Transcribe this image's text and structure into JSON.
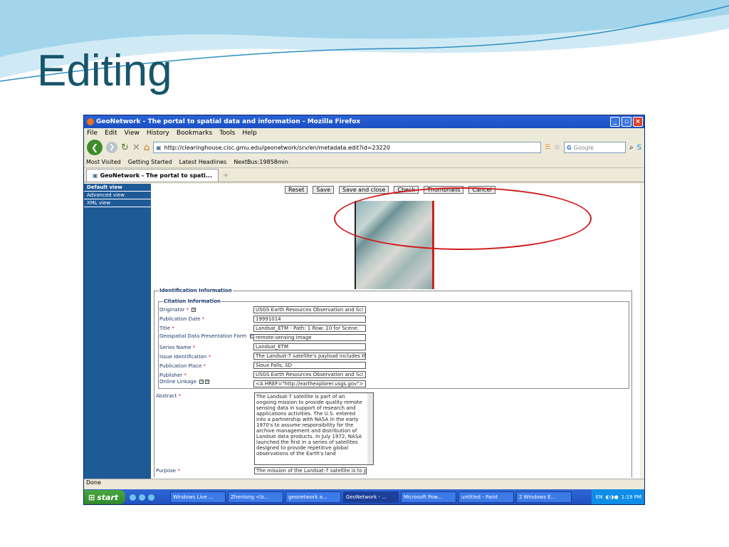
{
  "slide": {
    "title": "Editing"
  },
  "window": {
    "title": "GeoNetwork - The portal to spatial data and information - Mozilla Firefox"
  },
  "menu": [
    "File",
    "Edit",
    "View",
    "History",
    "Bookmarks",
    "Tools",
    "Help"
  ],
  "url": "http://clearinghouse.cisc.gmu.edu/geonetwork/srv/en/metadata.edit?id=23220",
  "search_placeholder": "Google",
  "bookmarks": [
    "Most Visited",
    "Getting Started",
    "Latest Headlines",
    "NextBus:19858min"
  ],
  "tab": {
    "label": "GeoNetwork - The portal to spati...",
    "new": "+"
  },
  "sidebar": [
    "Default view",
    "Advanced view",
    "XML view"
  ],
  "actions": [
    "Reset",
    "Save",
    "Save and close",
    "Check",
    "Thumbnails",
    "Cancel"
  ],
  "identification": {
    "title": "Identification Information",
    "citation_title": "Citation Information"
  },
  "fields": [
    {
      "label": "Originator",
      "value": "USGS Earth Resources Observation and Sci"
    },
    {
      "label": "Publication Date",
      "value": "19991014"
    },
    {
      "label": "Title",
      "value": "Landsat_ETM - Path: 1 Row: 10 for Scene:"
    },
    {
      "label": "Geospatial Data Presentation Form",
      "value": "remote-sensing image"
    },
    {
      "label": "Series Name",
      "value": "Landsat_ETM"
    },
    {
      "label": "Issue Identification",
      "value": "The Landsat-7 satellite's payload includes th"
    },
    {
      "label": "Publication Place",
      "value": "Sioux Falls, SD"
    },
    {
      "label": "Publisher",
      "value": "USGS Earth Resources Observation and Sci"
    },
    {
      "label": "Online Linkage",
      "value": "<A HREF=\"http://earthexplorer.usgs.gov\">"
    }
  ],
  "abstract": {
    "label": "Abstract",
    "text": "The Landsat-7 satellite is part of an ongoing mission to provide quality remote sensing data in support of research and applications activities. The U.S. entered into a partnership with NASA in the early 1970's to assume responsibility for the archive management and distribution of Landsat data products. In July 1972, NASA launched the first in a series of satellites designed to provide repetitive global observations of the Earth's land"
  },
  "purpose": {
    "label": "Purpose",
    "value": "The mission of the Landsat-7 satellite is to p"
  },
  "status": "Done",
  "taskbar": {
    "start": "start",
    "tasks": [
      "Windows Live ...",
      "Zhenlong <lz...",
      "geonetwork a...",
      "GeoNetwork - ...",
      "Microsoft Pow...",
      "untitled - Paint",
      "2 Windows E..."
    ],
    "lang": "EN",
    "time": "1:19 PM"
  }
}
